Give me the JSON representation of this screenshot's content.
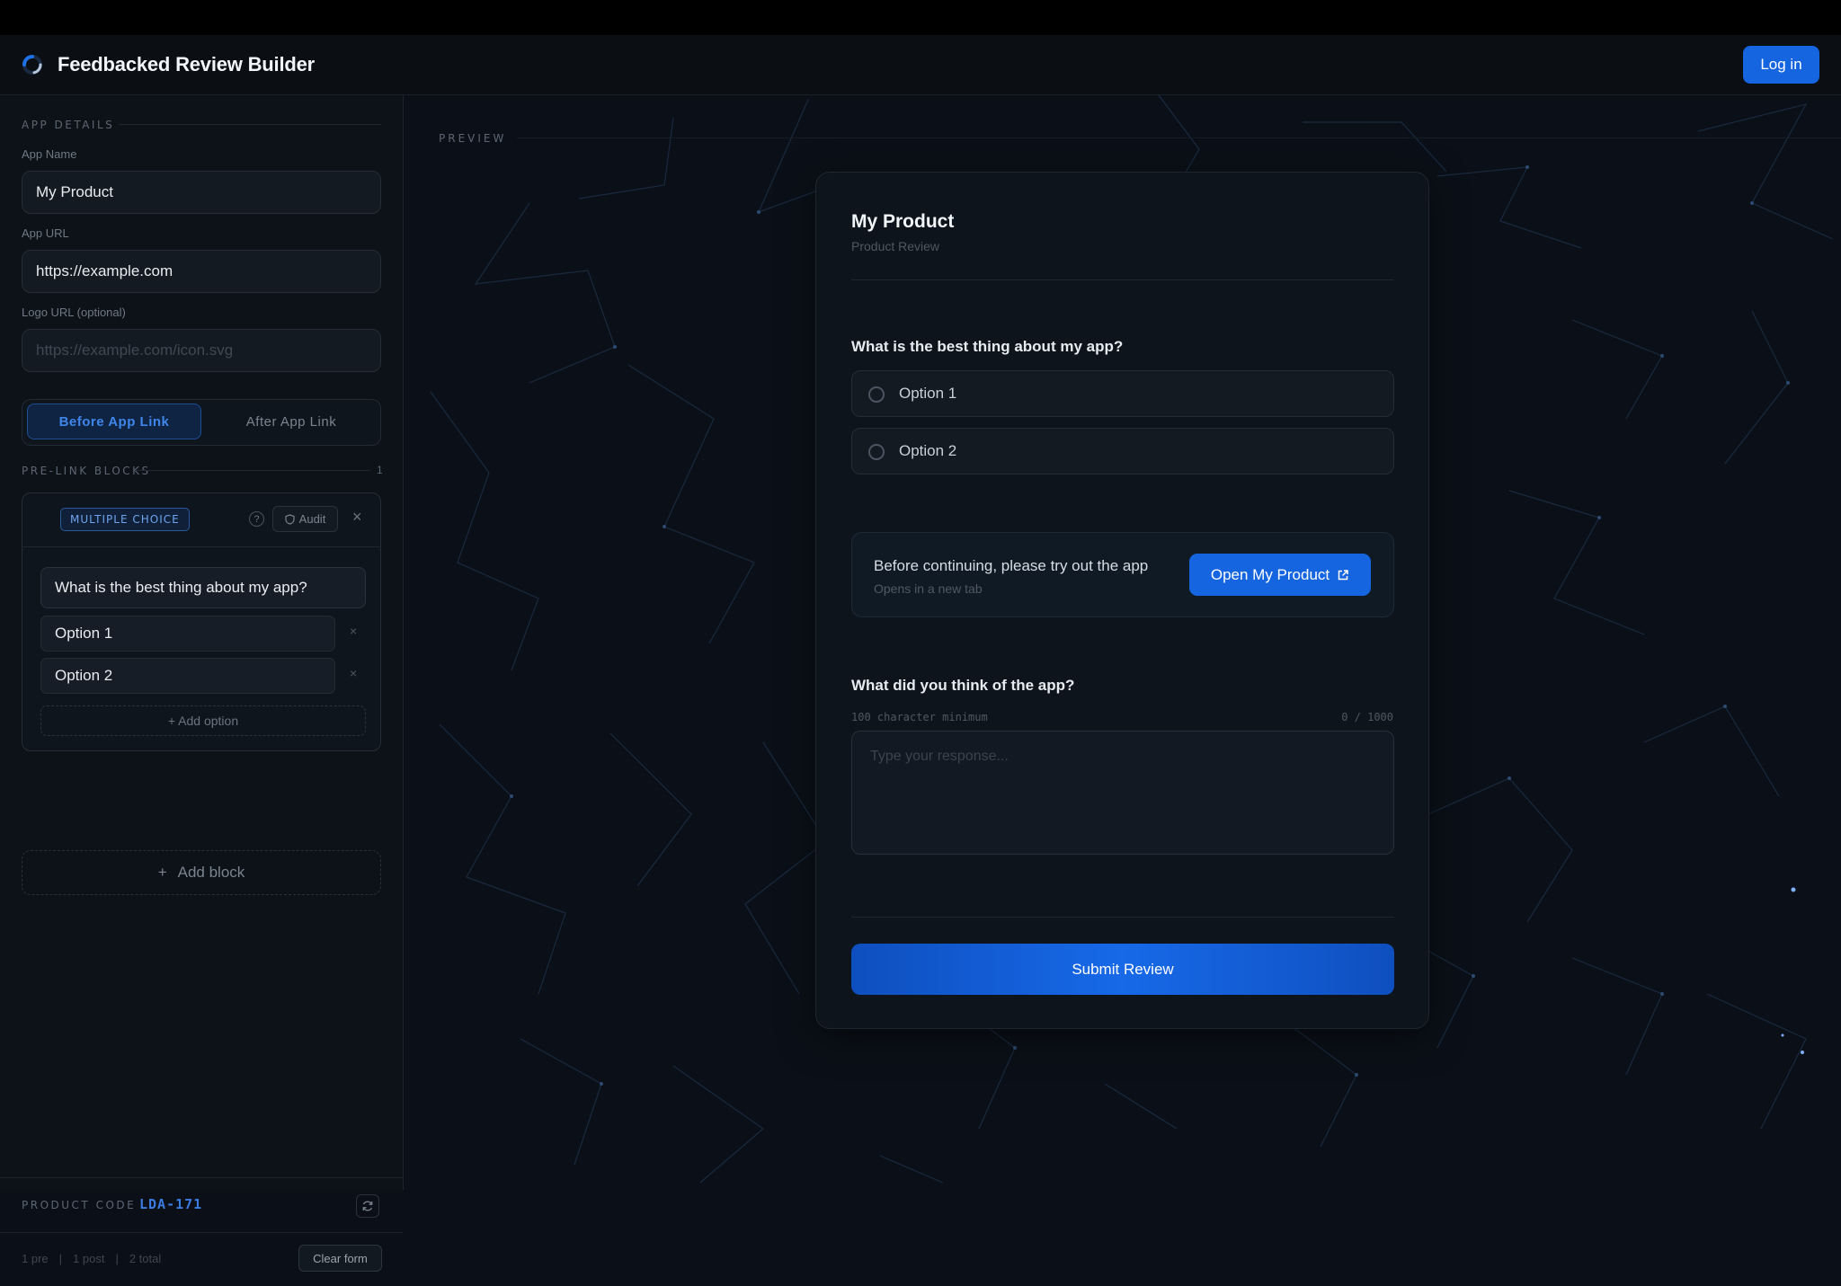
{
  "header": {
    "app_title": "Feedbacked Review Builder",
    "login_label": "Log in"
  },
  "sidebar": {
    "app_details_label": "APP DETAILS",
    "app_name_label": "App Name",
    "app_name_value": "My Product",
    "app_url_label": "App URL",
    "app_url_value": "https://example.com",
    "logo_url_label": "Logo URL (optional)",
    "logo_url_placeholder": "https://example.com/icon.svg",
    "tabs": [
      {
        "label": "Before App Link",
        "active": true
      },
      {
        "label": "After App Link",
        "active": false
      }
    ],
    "prelink_label": "PRE-LINK BLOCKS",
    "prelink_count": "1",
    "block": {
      "type_badge": "MULTIPLE CHOICE",
      "help_glyph": "?",
      "audit_label": "Audit",
      "question": "What is the best thing about my app?",
      "options": [
        "Option 1",
        "Option 2"
      ],
      "add_option_label": "+ Add option"
    },
    "add_block_label": "Add block",
    "product_code_label": "PRODUCT CODE",
    "product_code_value": "LDA-171",
    "stats": {
      "pre": "1 pre",
      "post": "1 post",
      "total": "2 total"
    },
    "clear_label": "Clear form"
  },
  "preview": {
    "label": "PREVIEW",
    "title": "My Product",
    "subtitle": "Product Review",
    "q1": {
      "title": "What is the best thing about my app?",
      "options": [
        "Option 1",
        "Option 2"
      ]
    },
    "link": {
      "text": "Before continuing, please try out the app",
      "sub": "Opens in a new tab",
      "button": "Open My Product"
    },
    "q2": {
      "title": "What did you think of the app?",
      "hint_left": "100 character minimum",
      "hint_right": "0 / 1000",
      "placeholder": "Type your response..."
    },
    "submit_label": "Submit Review"
  },
  "colors": {
    "accent": "#1565e0",
    "background": "#0b1018",
    "panel": "#0d1218"
  }
}
